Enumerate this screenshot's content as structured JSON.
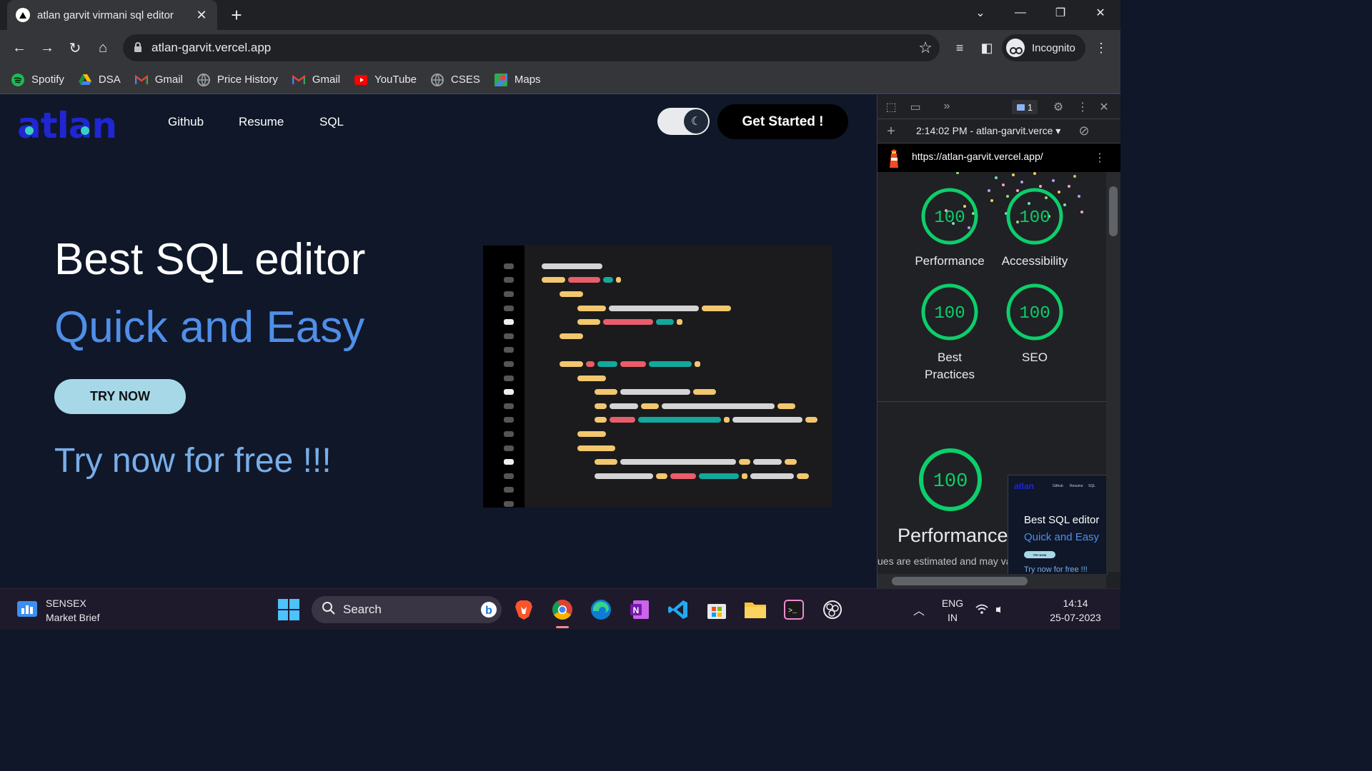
{
  "browser": {
    "tab_title": "atlan garvit virmani sql editor",
    "url": "atlan-garvit.vercel.app",
    "profile_label": "Incognito",
    "bookmarks": [
      {
        "label": "Spotify",
        "icon": "spotify-icon",
        "color": "#1db954"
      },
      {
        "label": "DSA",
        "icon": "google-drive-icon",
        "color": "#fbbc04"
      },
      {
        "label": "Gmail",
        "icon": "gmail-icon",
        "color": "#ea4335"
      },
      {
        "label": "Price History",
        "icon": "globe-icon",
        "color": "#9aa0a6"
      },
      {
        "label": "Gmail",
        "icon": "gmail-icon",
        "color": "#ea4335"
      },
      {
        "label": "YouTube",
        "icon": "youtube-icon",
        "color": "#ff0000"
      },
      {
        "label": "CSES",
        "icon": "globe-icon",
        "color": "#9aa0a6"
      },
      {
        "label": "Maps",
        "icon": "google-maps-icon",
        "color": "#34a853"
      }
    ]
  },
  "site": {
    "logo": "atlan",
    "nav": [
      "Github",
      "Resume",
      "SQL"
    ],
    "cta": "Get Started !",
    "hero_title": "Best SQL editor",
    "hero_subtitle": "Quick and Easy",
    "try_button": "TRY NOW",
    "free_text": "Try now for free !!!",
    "colors": {
      "background": "#0f1729",
      "brand": "#2026d2",
      "accent_blue": "#4f8fe8",
      "button": "#a7d8e8"
    }
  },
  "devtools": {
    "issues_count": "1",
    "report_time": "2:14:02 PM - atlan-garvit.verce",
    "report_url": "https://atlan-garvit.vercel.app/",
    "scores": [
      {
        "label": "Performance",
        "value": "100"
      },
      {
        "label": "Accessibility",
        "value": "100"
      },
      {
        "label": "Best Practices",
        "value": "100"
      },
      {
        "label": "SEO",
        "value": "100"
      }
    ],
    "main_score": {
      "label": "Performance",
      "value": "100"
    },
    "note": "ues are estimated and may va",
    "thumbnail": {
      "logo": "atlan",
      "nav": [
        "Github",
        "Resume",
        "SQL"
      ],
      "title": "Best SQL editor",
      "subtitle": "Quick and Easy",
      "button": "TRY NOW",
      "free": "Try now for free !!!"
    },
    "score_color": "#0cce6b"
  },
  "taskbar": {
    "widget_title": "SENSEX",
    "widget_subtitle": "Market Brief",
    "search_placeholder": "Search",
    "lang_line1": "ENG",
    "lang_line2": "IN",
    "time": "14:14",
    "date": "25-07-2023"
  }
}
